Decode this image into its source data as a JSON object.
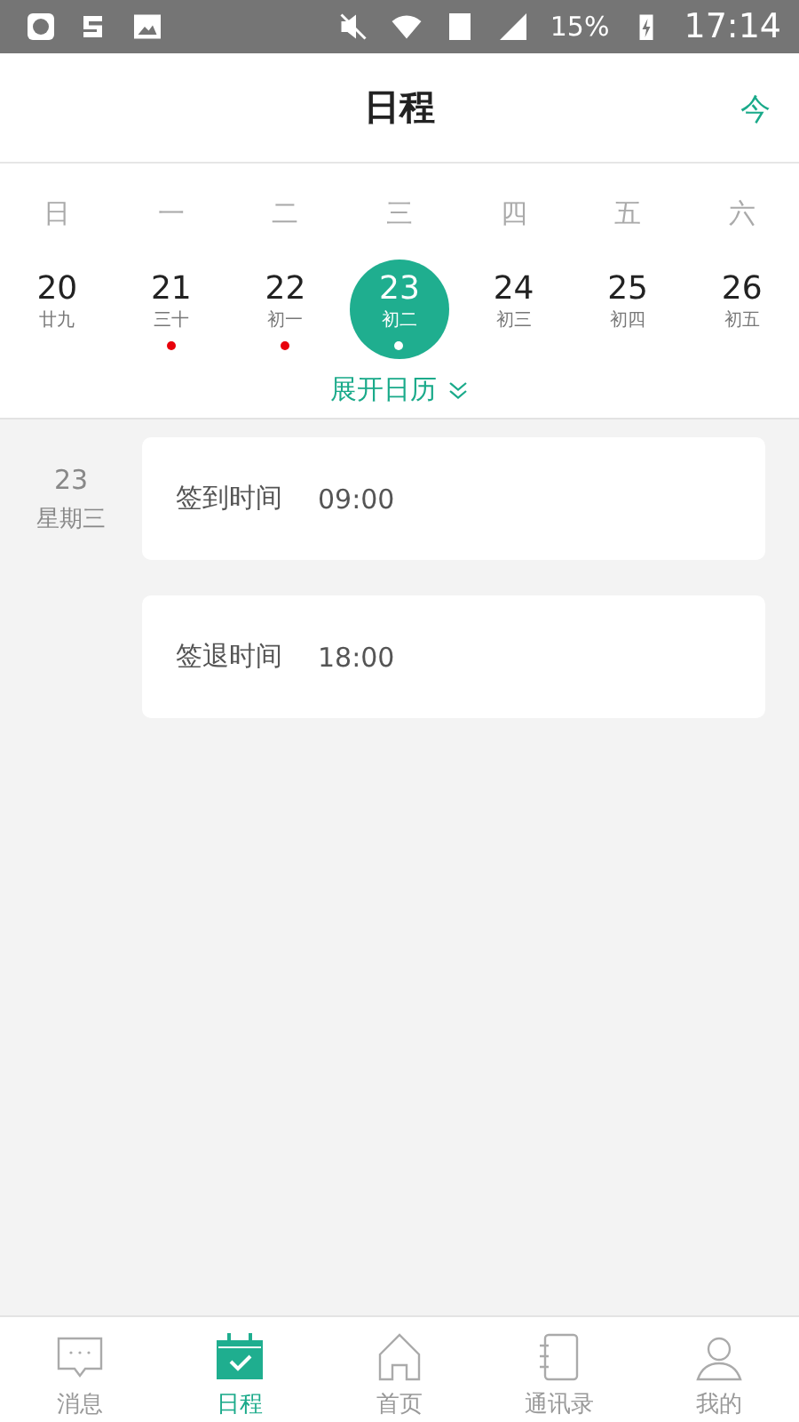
{
  "status_bar": {
    "battery": "15%",
    "time": "17:14"
  },
  "header": {
    "title": "日程",
    "today_button": "今"
  },
  "weekdays": [
    "日",
    "一",
    "二",
    "三",
    "四",
    "五",
    "六"
  ],
  "days": [
    {
      "number": "20",
      "lunar": "廿九",
      "has_event": false,
      "selected": false
    },
    {
      "number": "21",
      "lunar": "三十",
      "has_event": true,
      "selected": false
    },
    {
      "number": "22",
      "lunar": "初一",
      "has_event": true,
      "selected": false
    },
    {
      "number": "23",
      "lunar": "初二",
      "has_event": true,
      "selected": true
    },
    {
      "number": "24",
      "lunar": "初三",
      "has_event": false,
      "selected": false
    },
    {
      "number": "25",
      "lunar": "初四",
      "has_event": false,
      "selected": false
    },
    {
      "number": "26",
      "lunar": "初五",
      "has_event": false,
      "selected": false
    }
  ],
  "expand_link": "展开日历",
  "agenda": {
    "date": "23",
    "weekday": "星期三",
    "events": [
      {
        "label": "签到时间",
        "time": "09:00"
      },
      {
        "label": "签退时间",
        "time": "18:00"
      }
    ]
  },
  "tabs": [
    {
      "kind": "message",
      "label": "消息",
      "selected": false
    },
    {
      "kind": "calendar",
      "label": "日程",
      "selected": true
    },
    {
      "kind": "home",
      "label": "首页",
      "selected": false
    },
    {
      "kind": "contacts",
      "label": "通讯录",
      "selected": false
    },
    {
      "kind": "profile",
      "label": "我的",
      "selected": false
    }
  ]
}
